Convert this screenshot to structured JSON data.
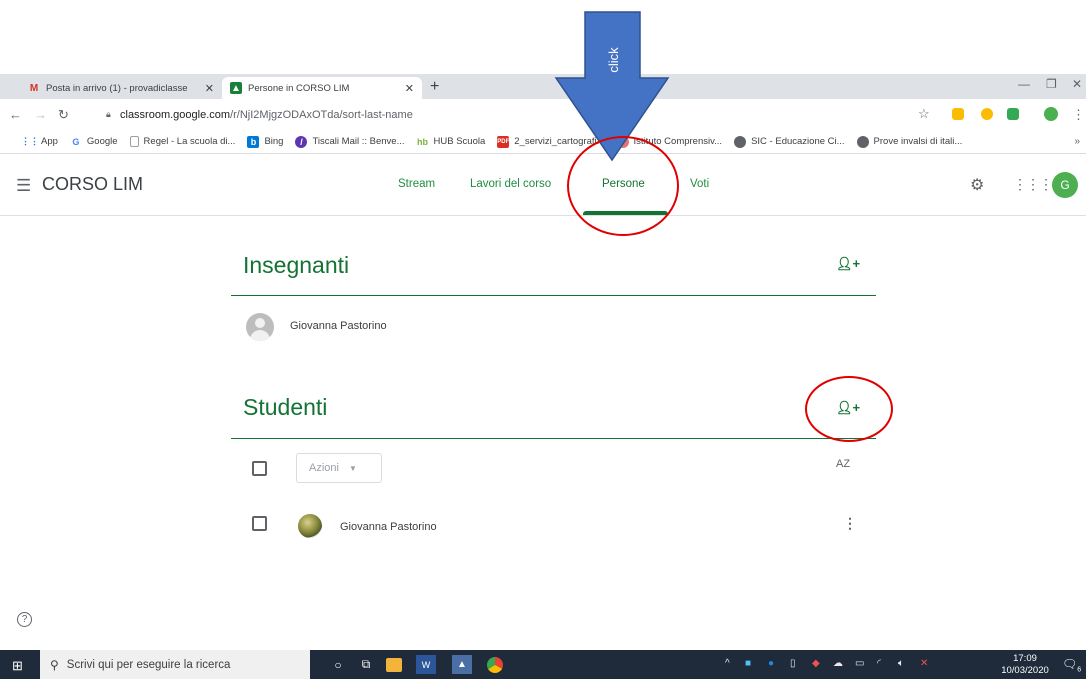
{
  "annotation": {
    "arrow_label": "click",
    "arrow_color": "#4472c4",
    "circle_color": "#e00000"
  },
  "browser": {
    "tabs": [
      {
        "label": "Posta in arrivo (1) - provadiclasse",
        "icon": "gmail-icon",
        "close": "✕"
      },
      {
        "label": "Persone in CORSO LIM",
        "icon": "classroom-icon",
        "close": "✕"
      }
    ],
    "new_tab": "+",
    "url_host": "classroom.google.com",
    "url_path": "/r/NjI2MjgzODAxOTda/sort-last-name",
    "bookmarks": [
      {
        "label": "App",
        "icon": "apps-grid-icon"
      },
      {
        "label": "Google",
        "icon": "google-icon"
      },
      {
        "label": "Regel - La scuola di...",
        "icon": "page-icon"
      },
      {
        "label": "Bing",
        "icon": "bing-icon"
      },
      {
        "label": "Tiscali Mail :: Benve...",
        "icon": "tiscali-icon"
      },
      {
        "label": "HUB Scuola",
        "icon": "hub-icon"
      },
      {
        "label": "2_servizi_cartografi...",
        "icon": "pdf-icon"
      },
      {
        "label": "Istituto Comprensiv...",
        "icon": "school-icon"
      },
      {
        "label": "SIC - Educazione Ci...",
        "icon": "globe-icon"
      },
      {
        "label": "Prove invalsi di itali...",
        "icon": "globe-icon"
      }
    ],
    "bookmarks_more": "»"
  },
  "header": {
    "course_name": "CORSO LIM",
    "tabs": [
      "Stream",
      "Lavori del corso",
      "Persone",
      "Voti"
    ],
    "active_tab": "Persone",
    "account_initial": "G"
  },
  "teachers": {
    "title": "Insegnanti",
    "list": [
      "Giovanna Pastorino"
    ]
  },
  "students": {
    "title": "Studenti",
    "actions_label": "Azioni",
    "sort_label": "AZ",
    "list": [
      "Giovanna Pastorino"
    ]
  },
  "taskbar": {
    "search_placeholder": "Scrivi qui per eseguire la ricerca",
    "time": "17:09",
    "date": "10/03/2020",
    "notification_count": "6"
  }
}
